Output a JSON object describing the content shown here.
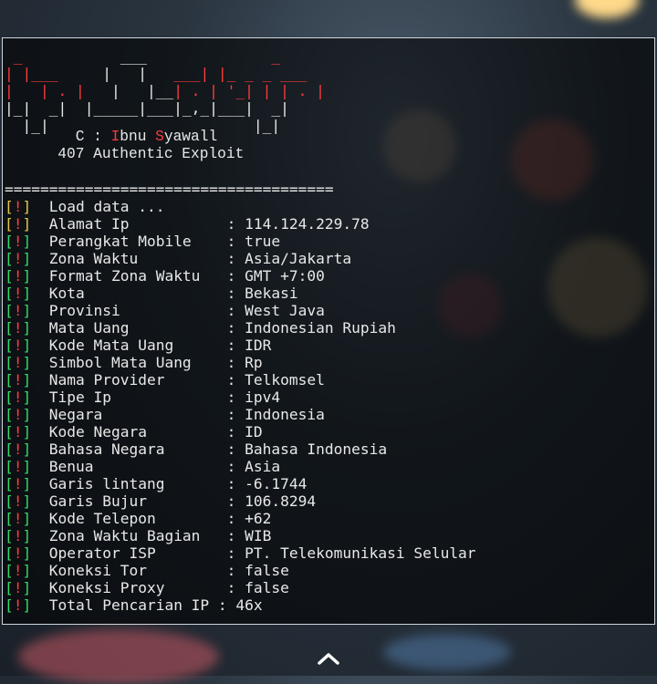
{
  "ascii_art": [
    [
      {
        "t": " _ ",
        "c": "r"
      },
      {
        "t": "          ___    ",
        "c": "w"
      },
      {
        "t": "          _",
        "c": "r"
      }
    ],
    [
      {
        "t": "| |",
        "c": "r"
      },
      {
        "t": "___",
        "c": "r"
      },
      {
        "t": "     |   |   ",
        "c": "w"
      },
      {
        "t": "___| |_ _ _ ___",
        "c": "r"
      }
    ],
    [
      {
        "t": "|   | . |",
        "c": "r"
      },
      {
        "t": "   |   |__",
        "c": "w"
      },
      {
        "t": "| . | '_| | | . |",
        "c": "r"
      }
    ],
    [
      {
        "t": "|_|  _|",
        "c": "w"
      },
      {
        "t": "  |_____|___|_,_|___|  _|",
        "c": "w"
      }
    ],
    [
      {
        "t": "  |_|",
        "c": "w"
      },
      {
        "t": "                       |_|",
        "c": "w"
      }
    ]
  ],
  "credit": {
    "line1_prefix": "        C : ",
    "line1_i": "I",
    "line1_bnu": "bnu ",
    "line1_s": "S",
    "line1_rest": "yawall",
    "line2": "      407 Authentic Exploit"
  },
  "separator": "=====================================",
  "rows": [
    {
      "mark": "!",
      "bracket": "yellow",
      "label": "Load data ...",
      "value": ""
    },
    {
      "mark": "!",
      "bracket": "yellow",
      "label": "Alamat Ip           ",
      "value": ": 114.124.229.78"
    },
    {
      "mark": "!",
      "bracket": "green",
      "label": "Perangkat Mobile    ",
      "value": ": true"
    },
    {
      "mark": "!",
      "bracket": "green",
      "label": "Zona Waktu          ",
      "value": ": Asia/Jakarta"
    },
    {
      "mark": "!",
      "bracket": "green",
      "label": "Format Zona Waktu   ",
      "value": ": GMT +7:00"
    },
    {
      "mark": "!",
      "bracket": "green",
      "label": "Kota                ",
      "value": ": Bekasi"
    },
    {
      "mark": "!",
      "bracket": "green",
      "label": "Provinsi            ",
      "value": ": West Java"
    },
    {
      "mark": "!",
      "bracket": "green",
      "label": "Mata Uang           ",
      "value": ": Indonesian Rupiah"
    },
    {
      "mark": "!",
      "bracket": "green",
      "label": "Kode Mata Uang      ",
      "value": ": IDR"
    },
    {
      "mark": "!",
      "bracket": "green",
      "label": "Simbol Mata Uang    ",
      "value": ": Rp"
    },
    {
      "mark": "!",
      "bracket": "green",
      "label": "Nama Provider       ",
      "value": ": Telkomsel"
    },
    {
      "mark": "!",
      "bracket": "green",
      "label": "Tipe Ip             ",
      "value": ": ipv4"
    },
    {
      "mark": "!",
      "bracket": "green",
      "label": "Negara              ",
      "value": ": Indonesia"
    },
    {
      "mark": "!",
      "bracket": "green",
      "label": "Kode Negara         ",
      "value": ": ID"
    },
    {
      "mark": "!",
      "bracket": "green",
      "label": "Bahasa Negara       ",
      "value": ": Bahasa Indonesia"
    },
    {
      "mark": "!",
      "bracket": "green",
      "label": "Benua               ",
      "value": ": Asia"
    },
    {
      "mark": "!",
      "bracket": "green",
      "label": "Garis lintang       ",
      "value": ": -6.1744"
    },
    {
      "mark": "!",
      "bracket": "green",
      "label": "Garis Bujur         ",
      "value": ": 106.8294"
    },
    {
      "mark": "!",
      "bracket": "green",
      "label": "Kode Telepon        ",
      "value": ": +62"
    },
    {
      "mark": "!",
      "bracket": "green",
      "label": "Zona Waktu Bagian   ",
      "value": ": WIB"
    },
    {
      "mark": "!",
      "bracket": "green",
      "label": "Operator ISP        ",
      "value": ": PT. Telekomunikasi Selular"
    },
    {
      "mark": "!",
      "bracket": "green",
      "label": "Koneksi Tor         ",
      "value": ": false"
    },
    {
      "mark": "!",
      "bracket": "green",
      "label": "Koneksi Proxy       ",
      "value": ": false"
    },
    {
      "mark": "!",
      "bracket": "green",
      "label": "Total Pencarian IP ",
      "value": ": 46x"
    }
  ],
  "colors": {
    "accent_red": "#ff3b3b",
    "bracket_green": "#38d96b",
    "bracket_yellow": "#e5c84a"
  },
  "icons": {
    "scroll_up": "chevron-up-icon"
  }
}
